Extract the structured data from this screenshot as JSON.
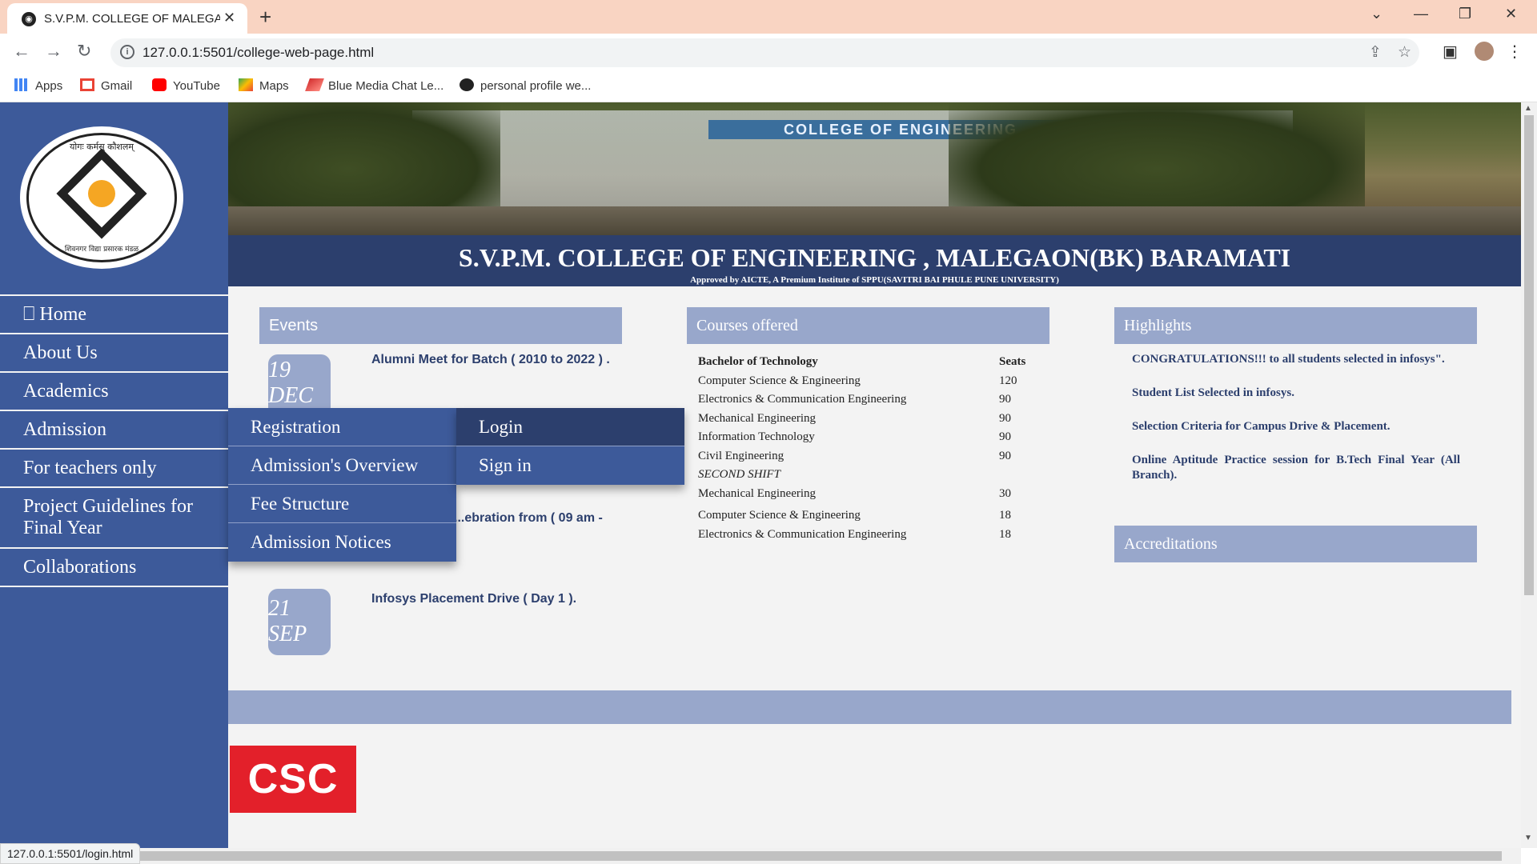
{
  "browser": {
    "tab_title": "S.V.P.M. COLLEGE OF MALEGAON",
    "url": "127.0.0.1:5501/college-web-page.html",
    "status_url": "127.0.0.1:5501/login.html",
    "bookmarks": [
      {
        "label": "Apps",
        "icon": "apps-grid-icon"
      },
      {
        "label": "Gmail",
        "icon": "gmail-icon"
      },
      {
        "label": "YouTube",
        "icon": "youtube-icon"
      },
      {
        "label": "Maps",
        "icon": "maps-icon"
      },
      {
        "label": "Blue Media Chat Le...",
        "icon": "bluemedia-icon"
      },
      {
        "label": "personal profile we...",
        "icon": "globe-icon"
      }
    ]
  },
  "site": {
    "logo_text_top": "योगः कर्मसु कौशलम्",
    "logo_text_bottom": "शिवनगर विद्या प्रसारक मंडळ",
    "banner_sign": "COLLEGE OF ENGINEERING",
    "title": "S.V.P.M. COLLEGE OF ENGINEERING , MALEGAON(BK) BARAMATI",
    "subtitle": "Approved by AICTE, A Premium Institute of SPPU(SAVITRI BAI PHULE PUNE UNIVERSITY)"
  },
  "nav": {
    "home_icon": "⎕",
    "items": [
      "Home",
      "About Us",
      "Academics",
      "Admission",
      "For teachers only",
      "Project Guidelines for Final Year",
      "Collaborations"
    ]
  },
  "admission_menu": [
    "Registration",
    "Admission's Overview",
    "Fee Structure",
    "Admission Notices"
  ],
  "registration_menu": [
    "Login",
    "Sign in"
  ],
  "events": {
    "heading": "Events",
    "items": [
      {
        "day": "19",
        "month": "DEC",
        "text": "Alumni Meet for Batch ( 2010 to 2022 ) ."
      },
      {
        "day": "",
        "month": "",
        "text": "...ebration from ( 09 am - "
      },
      {
        "day": "21",
        "month": "SEP",
        "text": "Infosys Placement Drive ( Day 1 )."
      }
    ]
  },
  "courses": {
    "heading": "Courses offered",
    "col_program": "Bachelor of Technology",
    "col_seats": "Seats",
    "rows": [
      {
        "name": "Computer Science & Engineering",
        "seats": "120"
      },
      {
        "name": "Electronics & Communication Engineering",
        "seats": "90"
      },
      {
        "name": "Mechanical Engineering",
        "seats": "90"
      },
      {
        "name": "Information Technology",
        "seats": "90"
      },
      {
        "name": "Civil Engineering",
        "seats": "90"
      }
    ],
    "second_shift_label": "SECOND SHIFT",
    "second_shift_rows": [
      {
        "name": "Mechanical Engineering",
        "seats": "30"
      },
      {
        "name": "Computer Science & Engineering",
        "seats": "18"
      },
      {
        "name": "Electronics & Communication Engineering",
        "seats": "18"
      }
    ]
  },
  "highlights": {
    "heading": "Highlights",
    "items": [
      "CONGRATULATIONS!!! to all students selected in infosys\".",
      "Student List Selected in infosys.",
      "Selection Criteria for Campus Drive & Placement.",
      "Online Aptitude Practice session for B.Tech Final Year (All Branch)."
    ]
  },
  "accreditations": {
    "heading": "Accreditations"
  },
  "footer_logo": "CSC",
  "colors": {
    "sidebar": "#3d5a9a",
    "titlebar": "#2c3f6d",
    "panel": "#98a7cb",
    "csc_red": "#e3202a",
    "chrome_tabbar": "#f9d4c2"
  }
}
